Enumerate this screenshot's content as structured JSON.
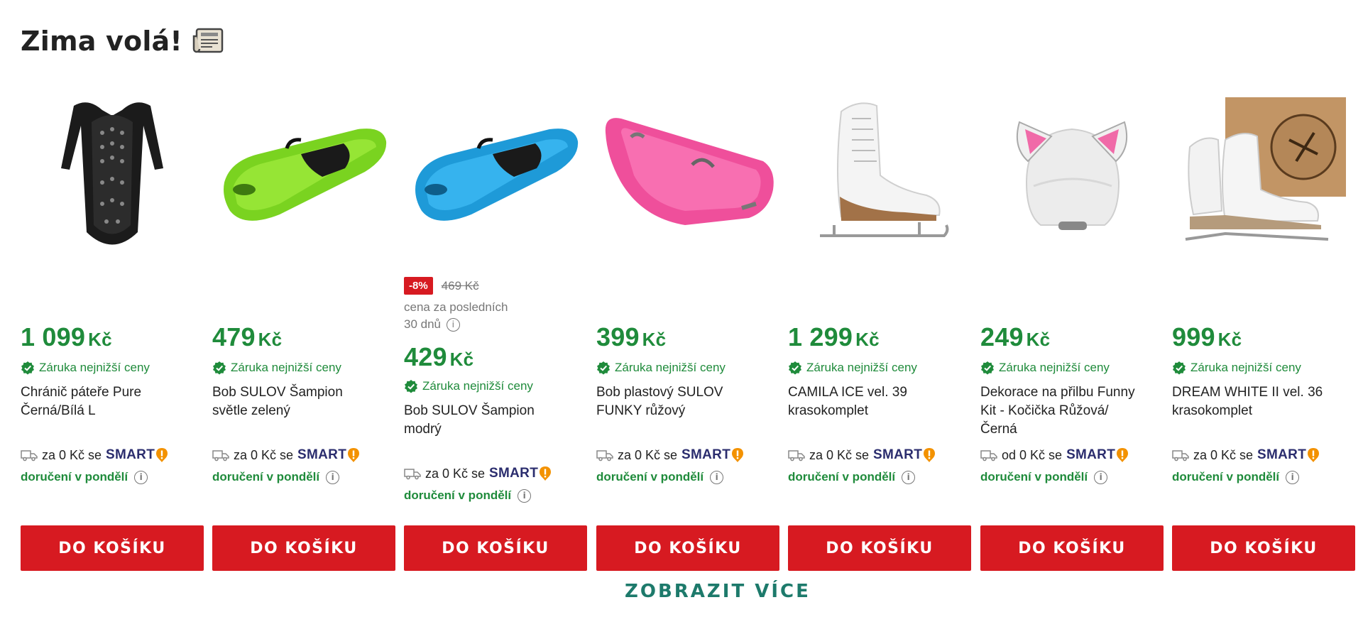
{
  "section": {
    "title": "Zima volá!",
    "title_icon": "newspaper-icon",
    "show_more_label": "ZOBRAZIT VÍCE"
  },
  "colors": {
    "price_green": "#1f8b3b",
    "button_red": "#d71a21",
    "smart_navy": "#2b2d6e",
    "smart_orange": "#f39200",
    "show_more_teal": "#1d7a6b"
  },
  "common": {
    "currency": "Kč",
    "guarantee_label": "Záruka nejnižší ceny",
    "smart_label": "SMART",
    "delivery_label": "doručení v pondělí",
    "add_to_cart_label": "DO KOŠÍKU",
    "info_glyph": "i"
  },
  "products": [
    {
      "image": "back-protector",
      "price": "1 099",
      "name_lines": [
        "Chránič páteře Pure",
        "Černá/Bílá L"
      ],
      "shipping": "za 0 Kč se"
    },
    {
      "image": "green-sled",
      "price": "479",
      "name_lines": [
        "Bob SULOV Šampion",
        "světle zelený"
      ],
      "shipping": "za 0 Kč se"
    },
    {
      "image": "blue-sled",
      "price": "429",
      "discount": {
        "badge": "-8%",
        "old_price": "469 Kč",
        "note_line1": "cena za posledních",
        "note_line2": "30 dnů"
      },
      "name_lines": [
        "Bob SULOV Šampion",
        "modrý"
      ],
      "shipping": "za 0 Kč se"
    },
    {
      "image": "pink-sled",
      "price": "399",
      "name_lines": [
        "Bob plastový SULOV",
        "FUNKY růžový"
      ],
      "shipping": "za 0 Kč se"
    },
    {
      "image": "figure-skates",
      "price": "1 299",
      "name_lines": [
        "CAMILA ICE vel. 39",
        "krasokomplet"
      ],
      "shipping": "za 0 Kč se"
    },
    {
      "image": "helmet-cat-ears",
      "price": "249",
      "name_lines": [
        "Dekorace na přilbu Funny",
        "Kit - Kočička Růžová/",
        "Černá"
      ],
      "shipping": "od 0 Kč se"
    },
    {
      "image": "skates-with-box",
      "price": "999",
      "name_lines": [
        "DREAM WHITE II vel. 36",
        "krasokomplet"
      ],
      "shipping": "za 0 Kč se"
    }
  ]
}
